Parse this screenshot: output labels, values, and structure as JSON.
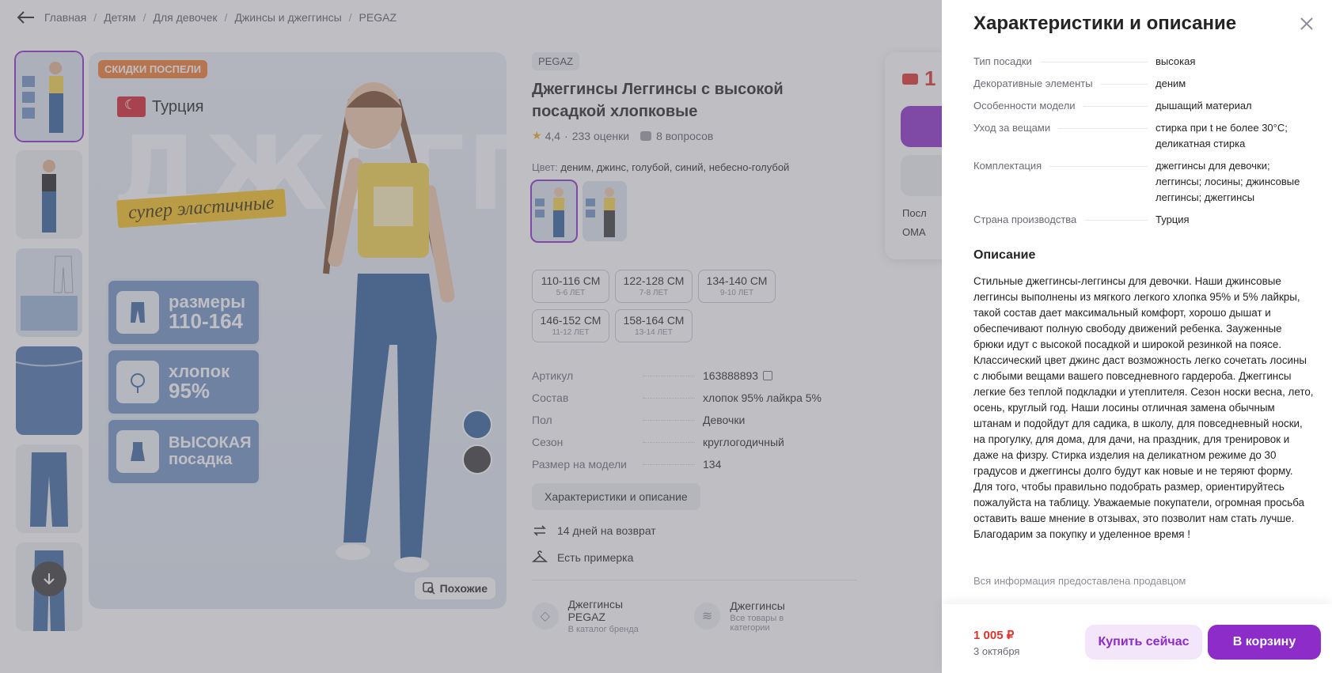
{
  "breadcrumb": {
    "items": [
      "Главная",
      "Детям",
      "Для девочек",
      "Джинсы и джеггинсы",
      "PEGAZ"
    ]
  },
  "hero": {
    "promo": "СКИДКИ ПОСПЕЛИ",
    "country": "Турция",
    "big_word": "ДЖЕГГИНСЫ",
    "ribbon": "супер эластичные",
    "badges": [
      {
        "line1": "размеры",
        "line2": "110-164",
        "icon": "jeans-icon"
      },
      {
        "line1": "хлопок",
        "line2": "95%",
        "icon": "cotton-icon"
      },
      {
        "line1": "ВЫСОКАЯ",
        "line2": "посадка",
        "icon": "high-waist-icon"
      }
    ],
    "similar_label": "Похожие"
  },
  "product": {
    "brand": "PEGAZ",
    "title": "Джеггинсы Леггинсы с высокой посадкой хлопковые",
    "rating": "4,4",
    "rating_sep": "·",
    "reviews": "233 оценки",
    "questions": "8 вопросов",
    "color_label": "Цвет:",
    "color_value": "деним, джинс, голубой, синий, небесно-голубой",
    "sizes": [
      {
        "cm": "110-116 СМ",
        "age": "5-6 ЛЕТ"
      },
      {
        "cm": "122-128 СМ",
        "age": "7-8 ЛЕТ"
      },
      {
        "cm": "134-140 СМ",
        "age": "9-10 ЛЕТ"
      },
      {
        "cm": "146-152 СМ",
        "age": "11-12 ЛЕТ"
      },
      {
        "cm": "158-164 СМ",
        "age": "13-14 ЛЕТ"
      }
    ],
    "specs": [
      {
        "k": "Артикул",
        "v": "163888893"
      },
      {
        "k": "Состав",
        "v": "хлопок 95% лайкра 5%"
      },
      {
        "k": "Пол",
        "v": "Девочки"
      },
      {
        "k": "Сезон",
        "v": "круглогодичный"
      },
      {
        "k": "Размер на модели",
        "v": "134"
      }
    ],
    "char_button": "Характеристики и описание",
    "return_text": "14 дней на возврат",
    "fitting_text": "Есть примерка",
    "links": [
      {
        "title": "Джеггинсы PEGAZ",
        "sub": "В каталог бренда"
      },
      {
        "title": "Джеггинсы",
        "sub": "Все товары в категории"
      }
    ]
  },
  "buybox": {
    "price_fragment": "1",
    "row1": "Посл",
    "row2": "ОМА"
  },
  "panel": {
    "title": "Характеристики и описание",
    "characteristics": [
      {
        "k": "Тип посадки",
        "v": "высокая"
      },
      {
        "k": "Декоративные элементы",
        "v": "деним"
      },
      {
        "k": "Особенности модели",
        "v": "дышащий материал"
      },
      {
        "k": "Уход за вещами",
        "v": "стирка при t не более 30°C; деликатная стирка"
      },
      {
        "k": "Комплектация",
        "v": "джеггинсы для девочки; леггинсы; лосины; джинсовые леггинсы; джеггинсы"
      },
      {
        "k": "Страна производства",
        "v": "Турция"
      }
    ],
    "description_title": "Описание",
    "description": "Стильные джеггинсы-леггинсы для девочки. Наши джинсовые леггинсы выполнены из мягкого легкого хлопка 95% и 5% лайкры, такой состав дает максимальный комфорт, хорошо дышат и обеспечивают полную свободу движений ребенка. Зауженные брюки идут с высокой посадкой и широкой резинкой на поясе. Классический цвет джинс даст возможность легко сочетать лосины с любыми вещами вашего повседневного гардероба. Джеггинсы легкие без теплой подкладки и утеплителя. Сезон носки весна, лето, осень, круглый год. Наши лосины отличная замена обычным штанам и подойдут для садика, в школу, для повседневный носки, на прогулку, для дома, для дачи, на праздник, для тренировок и даже на физру. Стирка изделия на деликатном режиме до 30 градусов и джеггинсы долго будут как новые и не теряют форму. Для того, чтобы правильно подобрать размер, ориентируйтесь пожалуйста на таблицу. Уважаемые покупатели, огромная просьба оставить ваше мнение в отзывах, это позволит нам стать лучше. Благодарим за покупку и уделенное время !",
    "seller_note": "Вся информация предоставлена продавцом",
    "footer": {
      "price": "1 005 ₽",
      "date": "3 октября",
      "buy_now": "Купить сейчас",
      "add_to_cart": "В корзину"
    }
  },
  "colors": {
    "accent": "#8d2cc8",
    "price": "#e0312b",
    "promo": "#f07b2b",
    "badge_blue": "#6f93c4",
    "ribbon_yellow": "#f6c21b"
  }
}
